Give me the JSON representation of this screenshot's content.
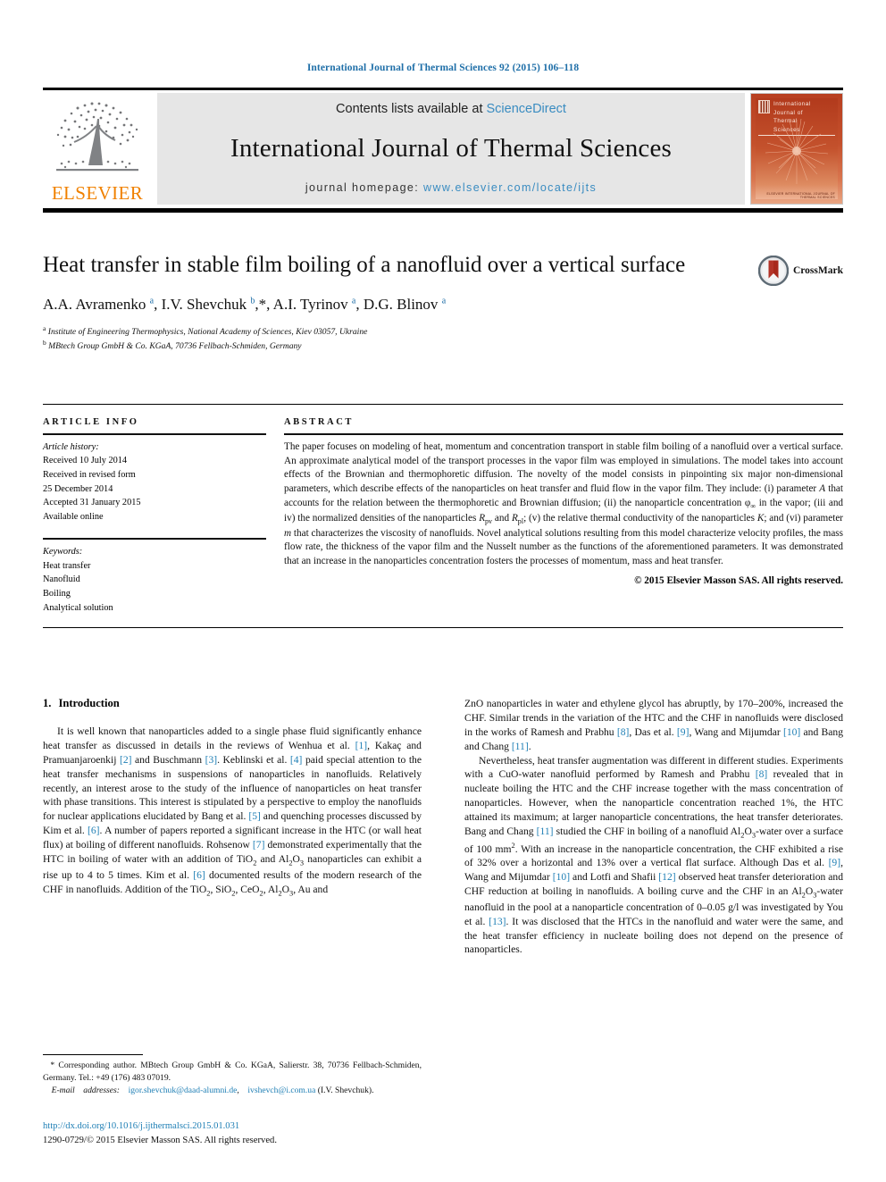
{
  "running_head": "International Journal of Thermal Sciences 92 (2015) 106–118",
  "masthead": {
    "contents_prefix": "Contents lists available at ",
    "sciencedirect": "ScienceDirect",
    "journal_title": "International Journal of Thermal Sciences",
    "homepage_prefix": "journal homepage: ",
    "homepage_url": "www.elsevier.com/locate/ijts",
    "publisher": "ELSEVIER",
    "cover_title_lines": [
      "International",
      "Journal of",
      "Thermal",
      "Sciences"
    ],
    "cover_footer": "ELSEVIER INTERNATIONAL JOURNAL OF THERMAL SCIENCES"
  },
  "article": {
    "title": "Heat transfer in stable film boiling of a nanofluid over a vertical surface",
    "crossmark_label": "CrossMark",
    "authors_html": "A.A. Avramenko <sup>a</sup>, I.V. Shevchuk <sup>b</sup><span class=\"star\">,*</span>, A.I. Tyrinov <sup>a</sup>, D.G. Blinov <sup>a</sup>",
    "affiliations": [
      {
        "marker": "a",
        "text": "Institute of Engineering Thermophysics, National Academy of Sciences, Kiev 03057, Ukraine"
      },
      {
        "marker": "b",
        "text": "MBtech Group GmbH & Co. KGaA, 70736 Fellbach-Schmiden, Germany"
      }
    ]
  },
  "article_info": {
    "heading": "ARTICLE INFO",
    "history_label": "Article history:",
    "history_lines": [
      "Received 10 July 2014",
      "Received in revised form",
      "25 December 2014",
      "Accepted 31 January 2015",
      "Available online"
    ],
    "keywords_label": "Keywords:",
    "keywords": [
      "Heat transfer",
      "Nanofluid",
      "Boiling",
      "Analytical solution"
    ]
  },
  "abstract": {
    "heading": "ABSTRACT",
    "paragraph_html": "The paper focuses on modeling of heat, momentum and concentration transport in stable film boiling of a nanofluid over a vertical surface. An approximate analytical model of the transport processes in the vapor film was employed in simulations. The model takes into account effects of the Brownian and thermophoretic diffusion. The novelty of the model consists in pinpointing six major non-dimensional parameters, which describe effects of the nanoparticles on heat transfer and fluid flow in the vapor film. They include: (i) parameter <i>A</i> that accounts for the relation between the thermophoretic and Brownian diffusion; (ii) the nanoparticle concentration &#966;<sub>&#8734;</sub> in the vapor; (iii and iv) the normalized densities of the nanoparticles <i>R</i><sub>pv</sub> and <i>R</i><sub>pl</sub>; (v) the relative thermal conductivity of the nanoparticles <i>K</i>; and (vi) parameter <i>m</i> that characterizes the viscosity of nanofluids. Novel analytical solutions resulting from this model characterize velocity profiles, the mass flow rate, the thickness of the vapor film and the Nusselt number as the functions of the aforementioned parameters. It was demonstrated that an increase in the nanoparticles concentration fosters the processes of momentum, mass and heat transfer.",
    "copyright": "© 2015 Elsevier Masson SAS. All rights reserved."
  },
  "body": {
    "section_number": "1.",
    "section_title": "Introduction",
    "left_paragraph_html": "It is well known that nanoparticles added to a single phase fluid significantly enhance heat transfer as discussed in details in the reviews of Wenhua et al. <span class=\"ref\">[1]</span>, Kaka&ccedil; and Pramuanjaroenkij <span class=\"ref\">[2]</span> and Buschmann <span class=\"ref\">[3]</span>. Keblinski et al. <span class=\"ref\">[4]</span> paid special attention to the heat transfer mechanisms in suspensions of nanoparticles in nanofluids. Relatively recently, an interest arose to the study of the influence of nanoparticles on heat transfer with phase transitions. This interest is stipulated by a perspective to employ the nanofluids for nuclear applications elucidated by Bang et al. <span class=\"ref\">[5]</span> and quenching processes discussed by Kim et al. <span class=\"ref\">[6]</span>. A number of papers reported a significant increase in the HTC (or wall heat flux) at boiling of different nanofluids. Rohsenow <span class=\"ref\">[7]</span> demonstrated experimentally that the HTC in boiling of water with an addition of TiO<sub>2</sub> and Al<sub>2</sub>O<sub>3</sub> nanoparticles can exhibit a rise up to 4 to 5 times. Kim et al. <span class=\"ref\">[6]</span> documented results of the modern research of the CHF in nanofluids. Addition of the TiO<sub>2</sub>, SiO<sub>2</sub>, CeO<sub>2</sub>, Al<sub>2</sub>O<sub>3</sub>, Au and",
    "right_paragraph1_html": "ZnO nanoparticles in water and ethylene glycol has abruptly, by 170&#8211;200%, increased the CHF. Similar trends in the variation of the HTC and the CHF in nanofluids were disclosed in the works of Ramesh and Prabhu <span class=\"ref\">[8]</span>, Das et al. <span class=\"ref\">[9]</span>, Wang and Mijumdar <span class=\"ref\">[10]</span> and Bang and Chang <span class=\"ref\">[11]</span>.",
    "right_paragraph2_html": "Nevertheless, heat transfer augmentation was different in different studies. Experiments with a CuO-water nanofluid performed by Ramesh and Prabhu <span class=\"ref\">[8]</span> revealed that in nucleate boiling the HTC and the CHF increase together with the mass concentration of nanoparticles. However, when the nanoparticle concentration reached 1%, the HTC attained its maximum; at larger nanoparticle concentrations, the heat transfer deteriorates. Bang and Chang <span class=\"ref\">[11]</span> studied the CHF in boiling of a nanofluid Al<sub>2</sub>O<sub>3</sub>-water over a surface of 100 mm<sup>2</sup>. With an increase in the nanoparticle concentration, the CHF exhibited a rise of 32% over a horizontal and 13% over a vertical flat surface. Although Das et al. <span class=\"ref\">[9]</span>, Wang and Mijumdar <span class=\"ref\">[10]</span> and Lotfi and Shafii <span class=\"ref\">[12]</span> observed heat transfer deterioration and CHF reduction at boiling in nanofluids. A boiling curve and the CHF in an Al<sub>2</sub>O<sub>3</sub>-water nanofluid in the pool at a nanoparticle concentration of 0&#8211;0.05 g/l was investigated by You et al. <span class=\"ref\">[13]</span>. It was disclosed that the HTCs in the nanofluid and water were the same, and the heat transfer efficiency in nucleate boiling does not depend on the presence of nanoparticles."
  },
  "footnote": {
    "corresponding_html": "<span class=\"fn-ind\">&nbsp;&nbsp;</span>* Corresponding author. MBtech Group GmbH &amp; Co. KGaA, Salierstr. 38, 70736 Fellbach-Schmiden, Germany. Tel.: +49 (176) 483 07019.",
    "email_html": "<span class=\"fn-ind\">&nbsp;&nbsp;&nbsp;&nbsp;</span><i>E-mail&nbsp;&nbsp;&nbsp;&nbsp;addresses:</i>&nbsp;&nbsp;&nbsp;&nbsp;<span class=\"lnk\">igor.shevchuk@daad-alumni.de</span>,&nbsp;&nbsp;&nbsp;&nbsp;<span class=\"lnk\">ivshevch@i.com.ua</span> (I.V. Shevchuk)."
  },
  "doi_block": {
    "doi_url": "http://dx.doi.org/10.1016/j.ijthermalsci.2015.01.031",
    "issn_line": "1290-0729/© 2015 Elsevier Masson SAS. All rights reserved."
  },
  "colors": {
    "link_blue": "#1f7fb5",
    "sciencedirect_blue": "#3a8cc1",
    "elsevier_orange": "#f08100",
    "cover_red": "#b83f20",
    "crossmark_red": "#a8281c"
  }
}
